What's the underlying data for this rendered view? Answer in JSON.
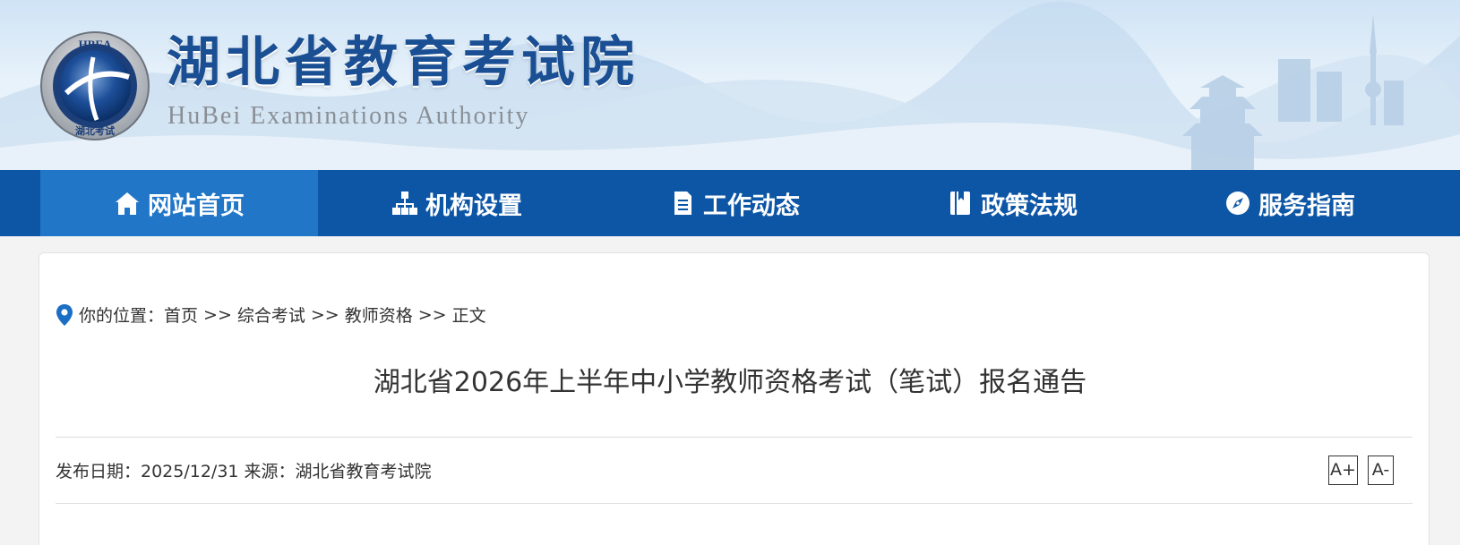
{
  "header": {
    "title": "湖北省教育考试院",
    "subtitle": "HuBei Examinations Authority",
    "logo_text_top": "HBEA",
    "logo_text_bottom": "湖北考试"
  },
  "nav": {
    "items": [
      {
        "label": "网站首页",
        "icon": "home-icon",
        "active": true
      },
      {
        "label": "机构设置",
        "icon": "org-chart-icon",
        "active": false
      },
      {
        "label": "工作动态",
        "icon": "document-icon",
        "active": false
      },
      {
        "label": "政策法规",
        "icon": "book-icon",
        "active": false
      },
      {
        "label": "服务指南",
        "icon": "compass-icon",
        "active": false
      }
    ]
  },
  "breadcrumb": {
    "prefix": "你的位置：",
    "items": [
      "首页",
      "综合考试",
      "教师资格",
      "正文"
    ],
    "separator": ">>"
  },
  "article": {
    "title": "湖北省2026年上半年中小学教师资格考试（笔试）报名通告",
    "meta": "发布日期：2025/12/31 来源：湖北省教育考试院"
  },
  "font_controls": {
    "increase": "A+",
    "decrease": "A-"
  },
  "colors": {
    "nav_bg": "#0d56a6",
    "nav_active": "#2176c7",
    "title_blue": "#1a4f94"
  }
}
